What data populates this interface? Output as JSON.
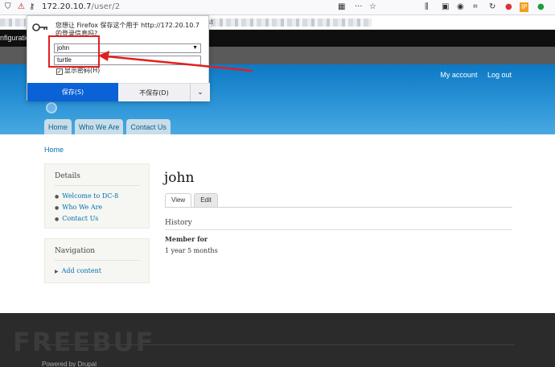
{
  "browser": {
    "url_host": "172.20.10.7",
    "url_path": "/user/2",
    "icons": [
      "shield-icon",
      "insecure-lock-icon",
      "key-icon",
      "qr-icon",
      "more-icon",
      "star-icon",
      "library-icon",
      "sidebar-icon",
      "account-icon",
      "extension-icons"
    ],
    "ip_badge": "IP"
  },
  "bookmarks": {
    "truncated_text": "st"
  },
  "admin_toolbar": {
    "config_label": "nfiguration"
  },
  "header": {
    "my_account": "My account",
    "log_out": "Log out",
    "tabs": [
      "Home",
      "Who We Are",
      "Contact Us"
    ]
  },
  "breadcrumb": "Home",
  "sidebar": {
    "details": {
      "title": "Details",
      "items": [
        "Welcome to DC-8",
        "Who We Are",
        "Contact Us"
      ]
    },
    "navigation": {
      "title": "Navigation",
      "items": [
        "Add content"
      ]
    }
  },
  "main": {
    "title": "john",
    "tabs": [
      "View",
      "Edit"
    ],
    "section_title": "History",
    "member_label": "Member for",
    "member_value": "1 year 5 months"
  },
  "footer": {
    "watermark": "FREEBUF",
    "powered": "Powered by Drupal"
  },
  "password_popup": {
    "message": "您想让 Firefox 保存这个用于 http://172.20.10.7 的登录信息吗?",
    "username": "john",
    "password": "turtle",
    "show_password": "显示密码(H)",
    "save_button": "保存(S)",
    "dont_save_button": "不保存(D)"
  },
  "colors": {
    "header_blue": "#0d79c4",
    "save_blue": "#0a62d6",
    "annotation_red": "#e02020",
    "link_blue": "#0071b3"
  }
}
